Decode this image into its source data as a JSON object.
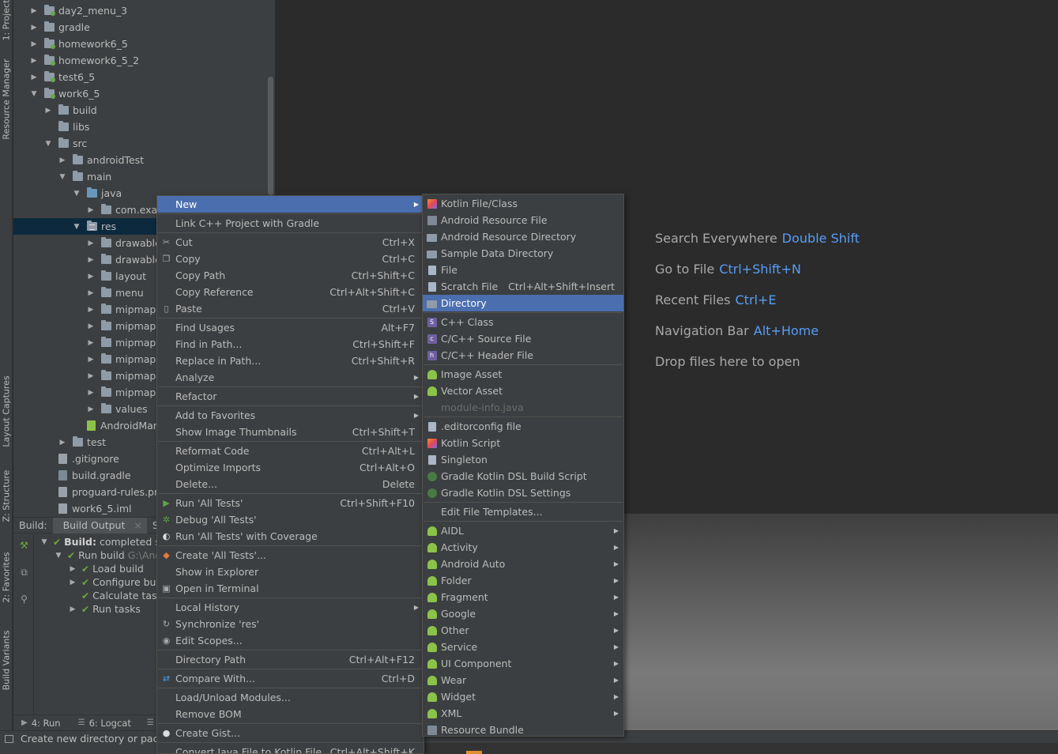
{
  "left_strip": {
    "tabs": [
      "1: Project",
      "Resource Manager",
      "Layout Captures",
      "Z: Structure",
      "2: Favorites",
      "Build Variants"
    ]
  },
  "project_tree": [
    {
      "label": "day2_menu_3",
      "arrow": "▶",
      "icon": "module-folder"
    },
    {
      "label": "gradle",
      "arrow": "▶",
      "icon": "folder"
    },
    {
      "label": "homework6_5",
      "arrow": "▶",
      "icon": "module-folder"
    },
    {
      "label": "homework6_5_2",
      "arrow": "▶",
      "icon": "module-folder"
    },
    {
      "label": "test6_5",
      "arrow": "▶",
      "icon": "module-folder"
    },
    {
      "label": "work6_5",
      "arrow": "▼",
      "icon": "module-folder"
    },
    {
      "label": "build",
      "arrow": "▶",
      "icon": "folder"
    },
    {
      "label": "libs",
      "arrow": "",
      "icon": "folder"
    },
    {
      "label": "src",
      "arrow": "▼",
      "icon": "folder"
    },
    {
      "label": "androidTest",
      "arrow": "▶",
      "icon": "folder"
    },
    {
      "label": "main",
      "arrow": "▼",
      "icon": "folder"
    },
    {
      "label": "java",
      "arrow": "▼",
      "icon": "blue-folder"
    },
    {
      "label": "com.exar",
      "arrow": "▶",
      "icon": "folder"
    },
    {
      "label": "res",
      "arrow": "▼",
      "icon": "res-folder"
    },
    {
      "label": "drawable",
      "arrow": "▶",
      "icon": "folder"
    },
    {
      "label": "drawable",
      "arrow": "▶",
      "icon": "folder"
    },
    {
      "label": "layout",
      "arrow": "▶",
      "icon": "folder"
    },
    {
      "label": "menu",
      "arrow": "▶",
      "icon": "folder"
    },
    {
      "label": "mipmap-",
      "arrow": "▶",
      "icon": "folder"
    },
    {
      "label": "mipmap-",
      "arrow": "▶",
      "icon": "folder"
    },
    {
      "label": "mipmap-",
      "arrow": "▶",
      "icon": "folder"
    },
    {
      "label": "mipmap-",
      "arrow": "▶",
      "icon": "folder"
    },
    {
      "label": "mipmap-",
      "arrow": "▶",
      "icon": "folder"
    },
    {
      "label": "mipmap-",
      "arrow": "▶",
      "icon": "folder"
    },
    {
      "label": "values",
      "arrow": "▶",
      "icon": "folder"
    },
    {
      "label": "AndroidMar",
      "arrow": "",
      "icon": "android-file"
    },
    {
      "label": "test",
      "arrow": "▶",
      "icon": "folder"
    },
    {
      "label": ".gitignore",
      "arrow": "",
      "icon": "file"
    },
    {
      "label": "build.gradle",
      "arrow": "",
      "icon": "gradle-file"
    },
    {
      "label": "proguard-rules.pr",
      "arrow": "",
      "icon": "file"
    },
    {
      "label": "work6_5.iml",
      "arrow": "",
      "icon": "file"
    }
  ],
  "build_panel": {
    "label": "Build:",
    "tab": "Build Output",
    "tab_close": "×",
    "tab2": "Sy",
    "rows": [
      {
        "arrow": "▼",
        "bold": "Build:",
        "text": " completed s",
        "gray": ""
      },
      {
        "arrow": "▼",
        "bold": "",
        "text": "Run build ",
        "gray": "G:\\And"
      },
      {
        "arrow": "▶",
        "bold": "",
        "text": "Load build",
        "gray": ""
      },
      {
        "arrow": "▶",
        "bold": "",
        "text": "Configure bu",
        "gray": ""
      },
      {
        "arrow": "",
        "bold": "",
        "text": "Calculate task",
        "gray": ""
      },
      {
        "arrow": "▶",
        "bold": "",
        "text": "Run tasks",
        "gray": ""
      }
    ]
  },
  "bottom_toolbar": {
    "run": "4: Run",
    "logcat": "6: Logcat"
  },
  "status_bar": {
    "text": "Create new directory or pack"
  },
  "editor_hints": [
    {
      "label": "Search Everywhere",
      "shortcut": "Double Shift"
    },
    {
      "label": "Go to File",
      "shortcut": "Ctrl+Shift+N"
    },
    {
      "label": "Recent Files",
      "shortcut": "Ctrl+E"
    },
    {
      "label": "Navigation Bar",
      "shortcut": "Alt+Home"
    },
    {
      "label": "Drop files here to open",
      "shortcut": ""
    }
  ],
  "context_menu": [
    {
      "label": "New",
      "shortcut": "",
      "submenu": true,
      "highlight": true,
      "icon": ""
    },
    {
      "sep": true
    },
    {
      "label": "Link C++ Project with Gradle",
      "shortcut": "",
      "icon": ""
    },
    {
      "sep": true
    },
    {
      "label": "Cut",
      "shortcut": "Ctrl+X",
      "icon": "scissors-icon",
      "glyph": "✂"
    },
    {
      "label": "Copy",
      "shortcut": "Ctrl+C",
      "icon": "copy-icon",
      "glyph": "❐"
    },
    {
      "label": "Copy Path",
      "shortcut": "Ctrl+Shift+C",
      "icon": ""
    },
    {
      "label": "Copy Reference",
      "shortcut": "Ctrl+Alt+Shift+C",
      "icon": ""
    },
    {
      "label": "Paste",
      "shortcut": "Ctrl+V",
      "icon": "paste-icon",
      "glyph": "▯"
    },
    {
      "sep": true
    },
    {
      "label": "Find Usages",
      "shortcut": "Alt+F7",
      "icon": ""
    },
    {
      "label": "Find in Path...",
      "shortcut": "Ctrl+Shift+F",
      "icon": ""
    },
    {
      "label": "Replace in Path...",
      "shortcut": "Ctrl+Shift+R",
      "icon": ""
    },
    {
      "label": "Analyze",
      "shortcut": "",
      "submenu": true,
      "icon": ""
    },
    {
      "sep": true
    },
    {
      "label": "Refactor",
      "shortcut": "",
      "submenu": true,
      "icon": ""
    },
    {
      "sep": true
    },
    {
      "label": "Add to Favorites",
      "shortcut": "",
      "submenu": true,
      "icon": ""
    },
    {
      "label": "Show Image Thumbnails",
      "shortcut": "Ctrl+Shift+T",
      "icon": ""
    },
    {
      "sep": true
    },
    {
      "label": "Reformat Code",
      "shortcut": "Ctrl+Alt+L",
      "icon": ""
    },
    {
      "label": "Optimize Imports",
      "shortcut": "Ctrl+Alt+O",
      "icon": ""
    },
    {
      "label": "Delete...",
      "shortcut": "Delete",
      "icon": ""
    },
    {
      "sep": true
    },
    {
      "label": "Run 'All Tests'",
      "shortcut": "Ctrl+Shift+F10",
      "icon": "run-icon",
      "glyph": "▶",
      "color": "green"
    },
    {
      "label": "Debug 'All Tests'",
      "shortcut": "",
      "icon": "debug-icon",
      "glyph": "✲",
      "color": "green"
    },
    {
      "label": "Run 'All Tests' with Coverage",
      "shortcut": "",
      "icon": "coverage-icon",
      "glyph": "◐",
      "color": "white"
    },
    {
      "sep": true
    },
    {
      "label": "Create 'All Tests'...",
      "shortcut": "",
      "icon": "create-config-icon",
      "glyph": "◆",
      "color": "orange"
    },
    {
      "label": "Show in Explorer",
      "shortcut": "",
      "icon": ""
    },
    {
      "label": "Open in Terminal",
      "shortcut": "",
      "icon": "terminal-icon",
      "glyph": "▣"
    },
    {
      "sep": true
    },
    {
      "label": "Local History",
      "shortcut": "",
      "submenu": true,
      "icon": ""
    },
    {
      "label": "Synchronize 'res'",
      "shortcut": "",
      "icon": "sync-icon",
      "glyph": "↻"
    },
    {
      "label": "Edit Scopes...",
      "shortcut": "",
      "icon": "scopes-icon",
      "glyph": "◉"
    },
    {
      "sep": true
    },
    {
      "label": "Directory Path",
      "shortcut": "Ctrl+Alt+F12",
      "icon": ""
    },
    {
      "sep": true
    },
    {
      "label": "Compare With...",
      "shortcut": "Ctrl+D",
      "icon": "compare-icon",
      "glyph": "⇄",
      "color": "blue"
    },
    {
      "sep": true
    },
    {
      "label": "Load/Unload Modules...",
      "shortcut": "",
      "icon": ""
    },
    {
      "label": "Remove BOM",
      "shortcut": "",
      "icon": ""
    },
    {
      "sep": true
    },
    {
      "label": "Create Gist...",
      "shortcut": "",
      "icon": "github-icon",
      "glyph": "●",
      "color": "white"
    },
    {
      "sep": true
    },
    {
      "label": "Convert Java File to Kotlin File",
      "shortcut": "Ctrl+Alt+Shift+K",
      "icon": ""
    }
  ],
  "new_submenu": [
    {
      "label": "Kotlin File/Class",
      "icon": "kotlin"
    },
    {
      "label": "Android Resource File",
      "icon": "res"
    },
    {
      "label": "Android Resource Directory",
      "icon": "folder"
    },
    {
      "label": "Sample Data Directory",
      "icon": "folder"
    },
    {
      "label": "File",
      "icon": "file"
    },
    {
      "label": "Scratch File",
      "shortcut": "Ctrl+Alt+Shift+Insert",
      "icon": "file"
    },
    {
      "label": "Directory",
      "icon": "folder",
      "highlight": true
    },
    {
      "sep": true
    },
    {
      "label": "C++ Class",
      "icon": "cpp",
      "glyph": "S"
    },
    {
      "label": "C/C++ Source File",
      "icon": "cpp",
      "glyph": "c"
    },
    {
      "label": "C/C++ Header File",
      "icon": "cpp",
      "glyph": "h"
    },
    {
      "sep": true
    },
    {
      "label": "Image Asset",
      "icon": "android"
    },
    {
      "label": "Vector Asset",
      "icon": "android"
    },
    {
      "label": "module-info.java",
      "icon": "",
      "disabled": true
    },
    {
      "sep": true
    },
    {
      "label": ".editorconfig file",
      "icon": "file"
    },
    {
      "label": "Kotlin Script",
      "icon": "kotlin"
    },
    {
      "label": "Singleton",
      "icon": "file"
    },
    {
      "label": "Gradle Kotlin DSL Build Script",
      "icon": "gradle"
    },
    {
      "label": "Gradle Kotlin DSL Settings",
      "icon": "gradle"
    },
    {
      "sep": true
    },
    {
      "label": "Edit File Templates...",
      "icon": ""
    },
    {
      "sep": true
    },
    {
      "label": "AIDL",
      "icon": "android",
      "submenu": true
    },
    {
      "label": "Activity",
      "icon": "android",
      "submenu": true
    },
    {
      "label": "Android Auto",
      "icon": "android",
      "submenu": true
    },
    {
      "label": "Folder",
      "icon": "android",
      "submenu": true
    },
    {
      "label": "Fragment",
      "icon": "android",
      "submenu": true
    },
    {
      "label": "Google",
      "icon": "android",
      "submenu": true
    },
    {
      "label": "Other",
      "icon": "android",
      "submenu": true
    },
    {
      "label": "Service",
      "icon": "android",
      "submenu": true
    },
    {
      "label": "UI Component",
      "icon": "android",
      "submenu": true
    },
    {
      "label": "Wear",
      "icon": "android",
      "submenu": true
    },
    {
      "label": "Widget",
      "icon": "android",
      "submenu": true
    },
    {
      "label": "XML",
      "icon": "android",
      "submenu": true
    },
    {
      "label": "Resource Bundle",
      "icon": "res"
    }
  ],
  "colors": {
    "selection": "#4b6eaf",
    "shortcut_link": "#589df6",
    "menu_bg": "#3c3f41",
    "editor_bg": "#2b2b2b"
  }
}
